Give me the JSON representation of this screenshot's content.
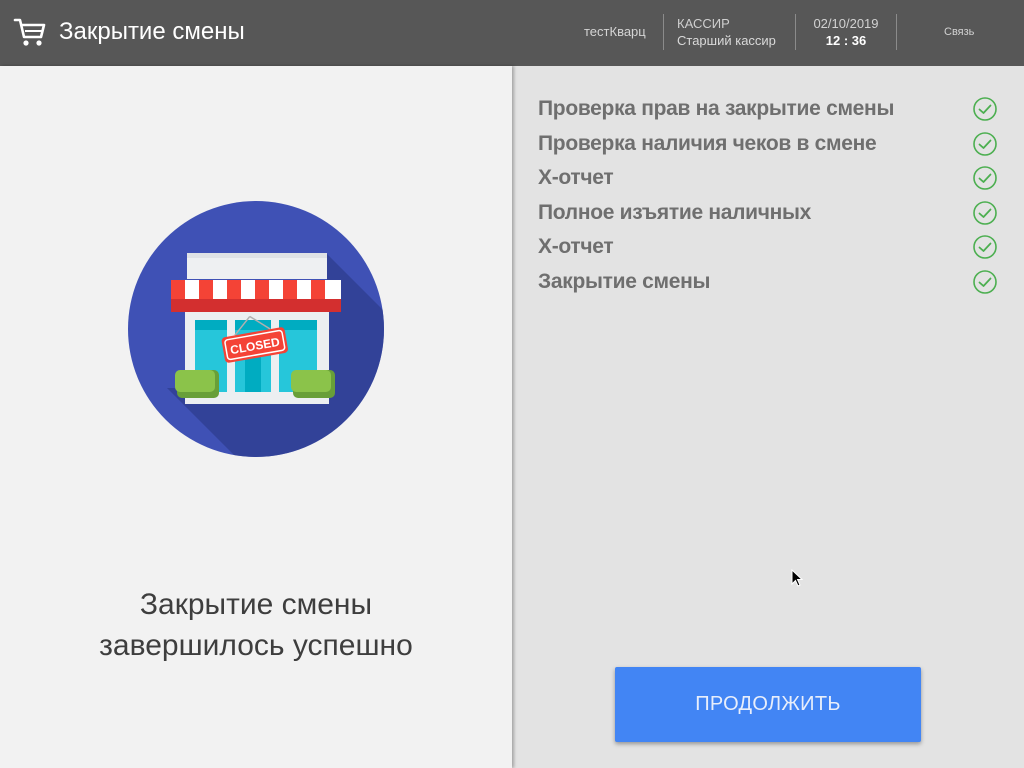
{
  "header": {
    "title": "Закрытие смены",
    "shop": "тестКварц",
    "role_title": "КАССИР",
    "role_name": "Старший кассир",
    "date": "02/10/2019",
    "time": "12 : 36",
    "link": "Связь"
  },
  "illustration": {
    "sign_text": "CLOSED"
  },
  "status": {
    "line1": "Закрытие смены",
    "line2": "завершилось успешно"
  },
  "steps": [
    {
      "label": "Проверка прав на закрытие смены",
      "status": "done"
    },
    {
      "label": "Проверка наличия чеков в смене",
      "status": "done"
    },
    {
      "label": "X-отчет",
      "status": "done"
    },
    {
      "label": "Полное изъятие наличных",
      "status": "done"
    },
    {
      "label": "X-отчет",
      "status": "done"
    },
    {
      "label": "Закрытие смены",
      "status": "done"
    }
  ],
  "continue_label": "ПРОДОЛЖИТЬ",
  "colors": {
    "header_bg": "#575757",
    "accent": "#4285f4",
    "check": "#4caf50",
    "circle": "#3f51b5"
  },
  "icons": {
    "header": "cart-icon",
    "step": "check-circle-icon"
  }
}
